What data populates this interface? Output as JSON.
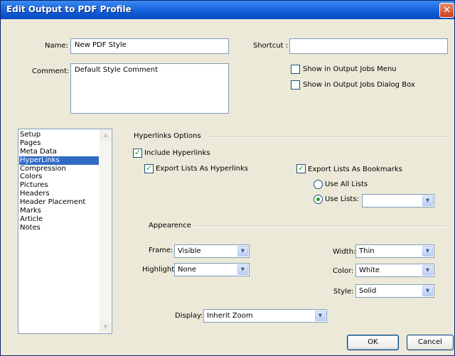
{
  "window": {
    "title": "Edit Output to PDF Profile",
    "close_glyph": "✕"
  },
  "form": {
    "name_label": "Name:",
    "name_value": "New PDF Style",
    "comment_label": "Comment:",
    "comment_value": "Default Style Comment",
    "shortcut_label": "Shortcut :",
    "shortcut_value": "",
    "show_in_menu_label": "Show in Output Jobs Menu",
    "show_in_menu_checked": false,
    "show_in_dialog_label": "Show in Output Jobs Dialog Box",
    "show_in_dialog_checked": false
  },
  "sidebar": {
    "items": [
      "Setup",
      "Pages",
      "Meta Data",
      "HyperLinks",
      "Compression",
      "Colors",
      "Pictures",
      "Headers",
      "Header Placement",
      "Marks",
      "Article",
      "Notes"
    ],
    "selected": "HyperLinks"
  },
  "hyperlinks": {
    "section_title": "Hyperlinks Options",
    "include_label": "Include Hyperlinks",
    "include_checked": true,
    "export_hyperlinks_label": "Export Lists As Hyperlinks",
    "export_hyperlinks_checked": true,
    "export_bookmarks_label": "Export Lists As Bookmarks",
    "export_bookmarks_checked": true,
    "use_all_lists_label": "Use All Lists",
    "use_lists_label": "Use Lists:",
    "use_lists_value": "",
    "selected_radio": "Use Lists:"
  },
  "appearance": {
    "section_title": "Appearence",
    "frame_label": "Frame:",
    "frame_value": "Visible",
    "highlight_label": "Highlight:",
    "highlight_value": "None",
    "width_label": "Width:",
    "width_value": "Thin",
    "color_label": "Color:",
    "color_value": "White",
    "style_label": "Style:",
    "style_value": "Solid",
    "display_label": "Display:",
    "display_value": "Inherit Zoom"
  },
  "buttons": {
    "ok": "OK",
    "cancel": "Cancel"
  },
  "glyphs": {
    "check": "✓",
    "dropdown": "▼",
    "scroll_up": "▲",
    "scroll_down": "▼"
  },
  "colors": {
    "title_bar": "#0a4bc3",
    "dialog_bg": "#ece9d8",
    "selection": "#316ac5",
    "check_green": "#21a121"
  }
}
